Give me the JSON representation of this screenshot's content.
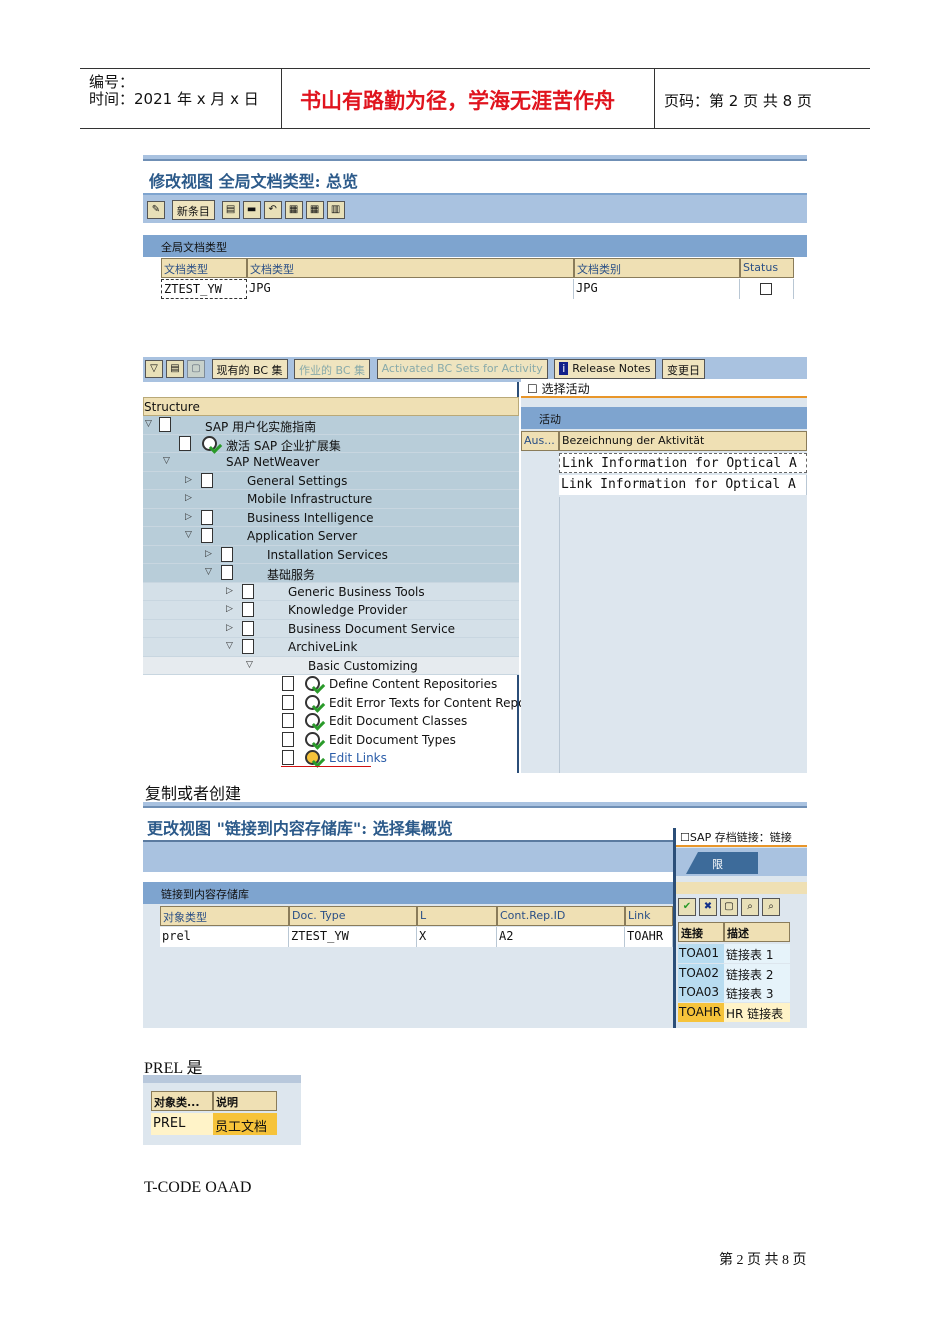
{
  "header": {
    "number_label": "编号：",
    "time_label": "时间：2021 年 x 月 x 日",
    "motto": "书山有路勤为径，学海无涯苦作舟",
    "page_label": "页码：第 2 页 共 8 页"
  },
  "shot1": {
    "title": "修改视图 全局文档类型: 总览",
    "new_entry": "新条目",
    "section": "全局文档类型",
    "columns": [
      "文档类型",
      "文档类型",
      "文档类别",
      "Status"
    ],
    "row": [
      "ZTEST_YW",
      "JPG",
      "JPG"
    ]
  },
  "shot2": {
    "toolbar": [
      "现有的 BC 集",
      "作业的 BC 集",
      "Activated BC Sets for Activity",
      "Release Notes",
      "变更日"
    ],
    "structure_header": "Structure",
    "tree": [
      "SAP 用户化实施指南",
      "激活 SAP 企业扩展集",
      "SAP NetWeaver",
      "General Settings",
      "Mobile Infrastructure",
      "Business Intelligence",
      "Application Server",
      "Installation Services",
      "基础服务",
      "Generic Business Tools",
      "Knowledge Provider",
      "Business Document Service",
      "ArchiveLink",
      "Basic Customizing",
      "Define Content Repositories",
      "Edit Error Texts for Content Repo",
      "Edit Document Classes",
      "Edit Document Types",
      "Edit Links"
    ],
    "popup_title": "选择活动",
    "popup_section": "活动",
    "popup_cols": [
      "Aus...",
      "Bezeichnung der Aktivität"
    ],
    "popup_rows": [
      "Link Information for Optical A",
      "Link Information for Optical A"
    ]
  },
  "caption1": "复制或者创建",
  "shot3": {
    "title": "更改视图 \"链接到内容存储库\": 选择集概览",
    "section": "链接到内容存储库",
    "columns": [
      "对象类型",
      "Doc. Type",
      "L",
      "Cont.Rep.ID",
      "Link"
    ],
    "row": [
      "prel",
      "ZTEST_YW",
      "X",
      "A2",
      "TOAHR"
    ],
    "popup_title": "SAP 存档链接：链接",
    "popup_tab": "限制",
    "popup_cols": [
      "连接",
      "描述"
    ],
    "popup_rows": [
      [
        "TOA01",
        "链接表 1"
      ],
      [
        "TOA02",
        "链接表 2"
      ],
      [
        "TOA03",
        "链接表 3"
      ],
      [
        "TOAHR",
        "HR 链接表"
      ]
    ]
  },
  "caption2": "PREL 是",
  "shot4": {
    "columns": [
      "对象类...",
      "说明"
    ],
    "row": [
      "PREL",
      "员工文档"
    ]
  },
  "caption3": "T-CODE OAAD",
  "footer": "第 2 页 共 8 页"
}
